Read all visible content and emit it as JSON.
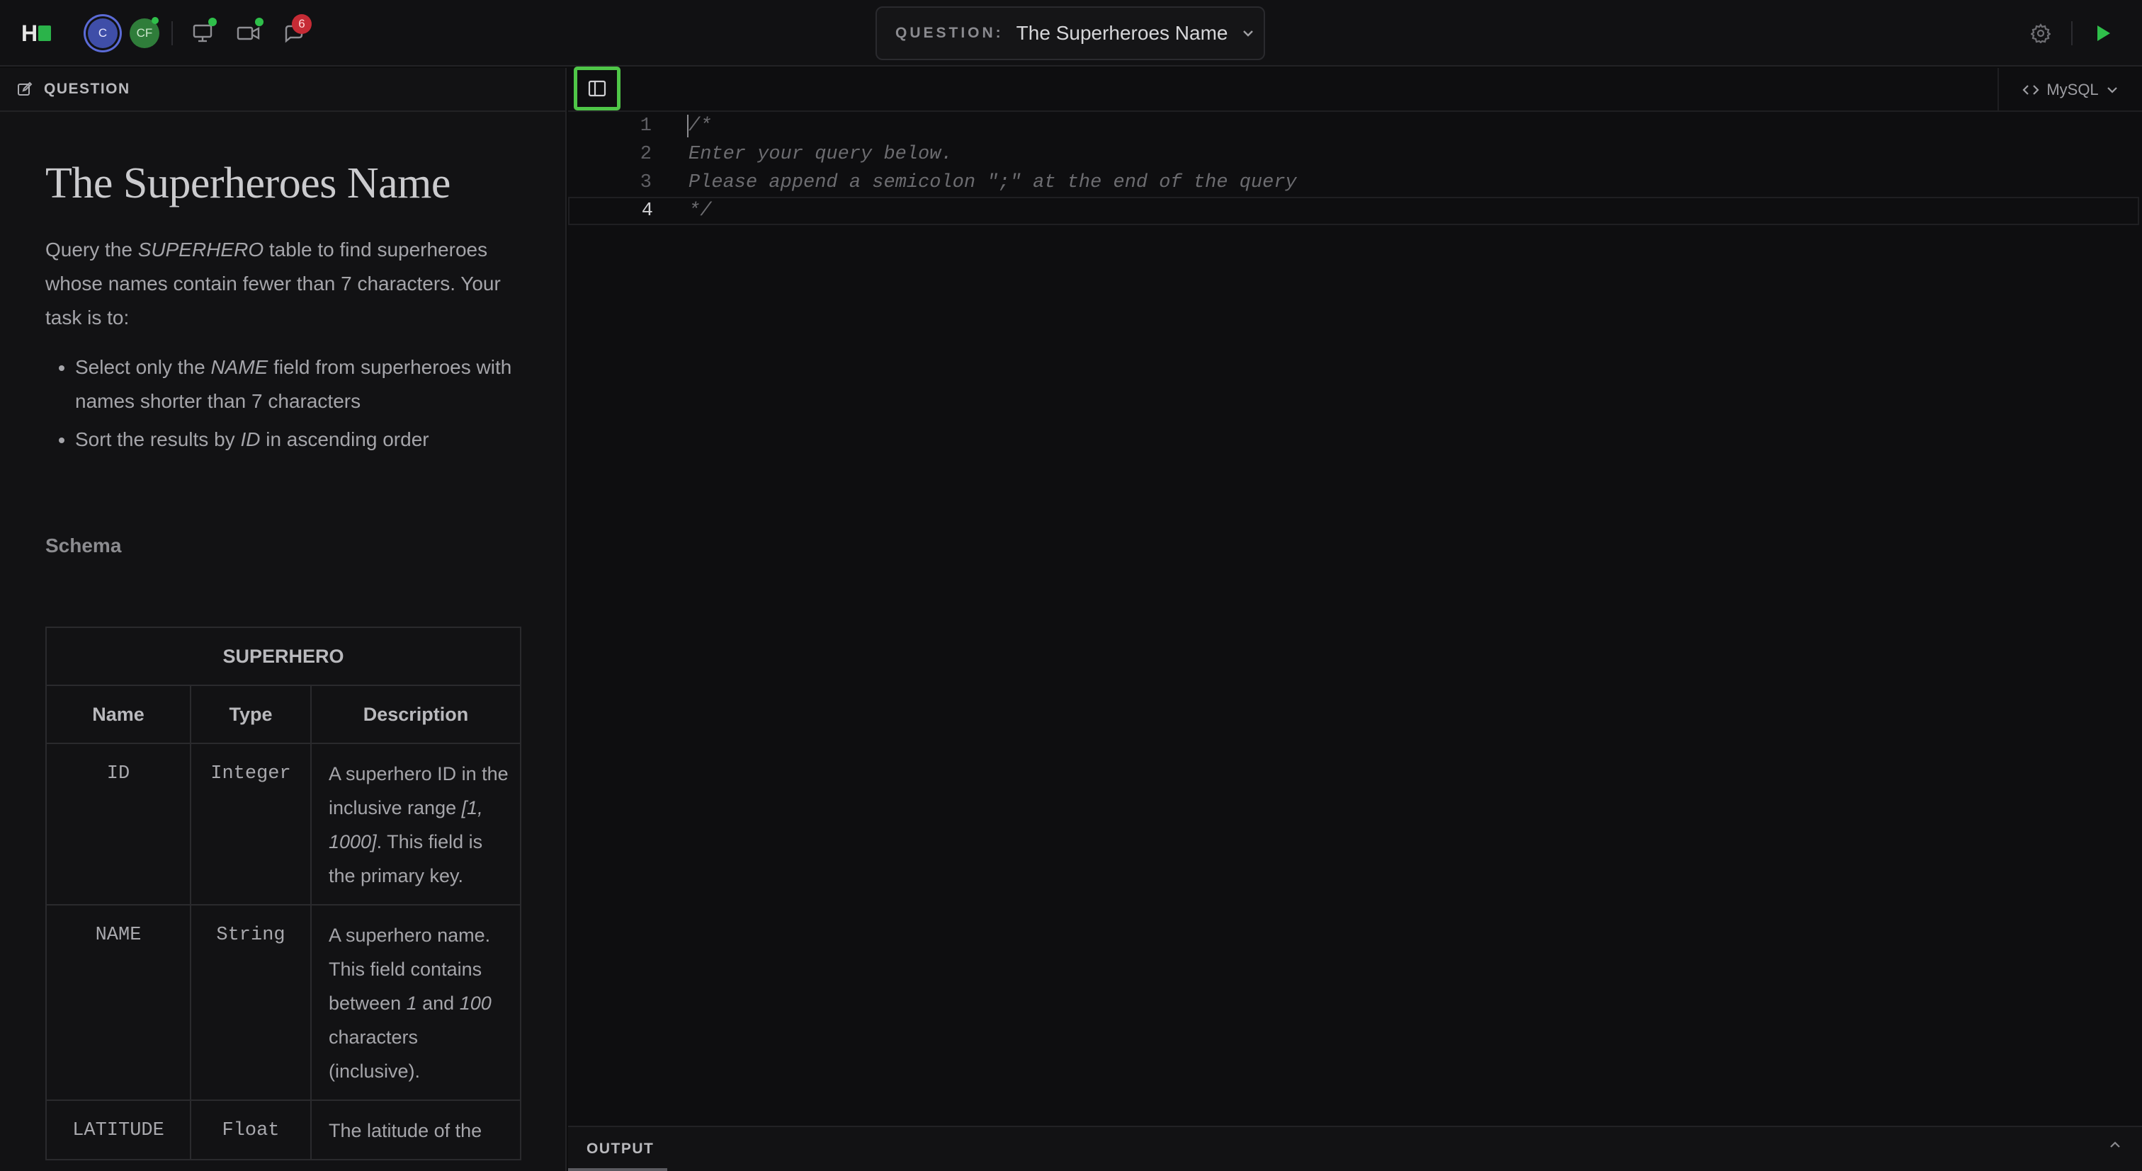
{
  "topbar": {
    "logo": "H",
    "avatars": [
      "C",
      "CF"
    ],
    "notification_count": "6",
    "question_label": "QUESTION:",
    "question_value": "The Superheroes Name",
    "icons": [
      "screen-share-icon",
      "video-camera-icon",
      "chat-icon",
      "gear-icon",
      "play-icon"
    ]
  },
  "left_panel": {
    "header": "QUESTION",
    "title": "The Superheroes Name",
    "desc_pre": "Query the ",
    "desc_table": "SUPERHERO",
    "desc_post": " table to find superheroes whose names contain fewer than 7 characters. Your task is to:",
    "bullet1_pre": "Select only the ",
    "bullet1_em": "NAME",
    "bullet1_post": " field from superheroes with names shorter than 7 characters",
    "bullet2_pre": "Sort the results by ",
    "bullet2_em": "ID",
    "bullet2_post": " in ascending order",
    "schema_label": "Schema",
    "table": {
      "name": "SUPERHERO",
      "headers": [
        "Name",
        "Type",
        "Description"
      ],
      "rows": [
        {
          "name": "ID",
          "type": "Integer",
          "desc_a": "A superhero ID in the inclusive range ",
          "desc_em": "[1, 1000]",
          "desc_b": ". This field is the primary key."
        },
        {
          "name": "NAME",
          "type": "String",
          "desc_a": "A superhero name. This field contains between ",
          "desc_em": "1",
          "desc_b": " and ",
          "desc_em2": "100",
          "desc_c": " characters (inclusive)."
        },
        {
          "name": "LATITUDE",
          "type": "Float",
          "desc_a": "The latitude of the"
        }
      ]
    }
  },
  "editor": {
    "language": "MySQL",
    "lines": [
      {
        "n": "1",
        "text": "/*"
      },
      {
        "n": "2",
        "text": "Enter your query below."
      },
      {
        "n": "3",
        "text": "Please append a semicolon \";\" at the end of the query"
      },
      {
        "n": "4",
        "text": "*/"
      }
    ]
  },
  "output": {
    "label": "OUTPUT"
  }
}
